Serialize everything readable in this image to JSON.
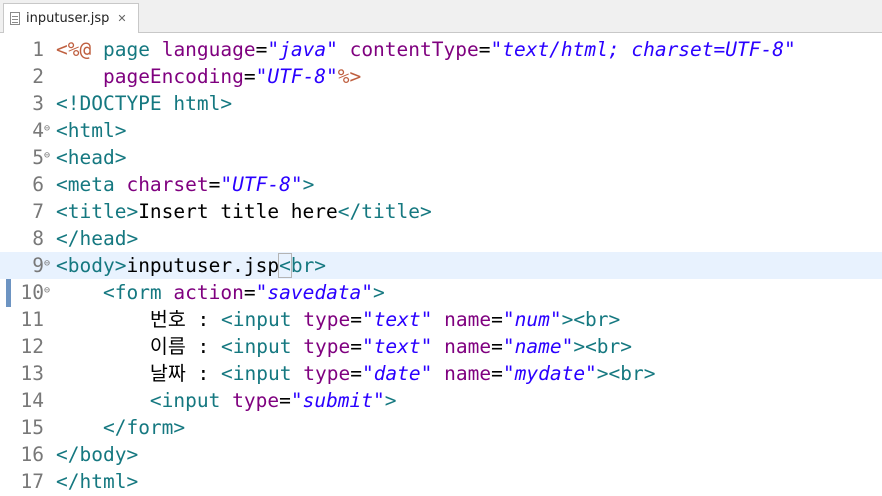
{
  "tab": {
    "filename": "inputuser.jsp",
    "close_glyph": "✕"
  },
  "editor": {
    "current_line": 9,
    "lines": [
      {
        "num": "1",
        "fold": false,
        "tokens": [
          {
            "t": "<%@",
            "c": "jsp"
          },
          {
            "t": " "
          },
          {
            "t": "page",
            "c": "tag"
          },
          {
            "t": " "
          },
          {
            "t": "language",
            "c": "attr"
          },
          {
            "t": "="
          },
          {
            "t": "\"java\"",
            "c": "str"
          },
          {
            "t": " "
          },
          {
            "t": "contentType",
            "c": "attr"
          },
          {
            "t": "="
          },
          {
            "t": "\"text/html; charset=UTF-8\"",
            "c": "str"
          }
        ]
      },
      {
        "num": "2",
        "fold": false,
        "tokens": [
          {
            "t": "    "
          },
          {
            "t": "pageEncoding",
            "c": "attr"
          },
          {
            "t": "="
          },
          {
            "t": "\"UTF-8\"",
            "c": "str"
          },
          {
            "t": "%>",
            "c": "jsp"
          }
        ]
      },
      {
        "num": "3",
        "fold": false,
        "tokens": [
          {
            "t": "<!DOCTYPE html>",
            "c": "tag"
          }
        ]
      },
      {
        "num": "4",
        "fold": true,
        "tokens": [
          {
            "t": "<html>",
            "c": "tag"
          }
        ]
      },
      {
        "num": "5",
        "fold": true,
        "tokens": [
          {
            "t": "<head>",
            "c": "tag"
          }
        ]
      },
      {
        "num": "6",
        "fold": false,
        "tokens": [
          {
            "t": "<meta",
            "c": "tag"
          },
          {
            "t": " "
          },
          {
            "t": "charset",
            "c": "attr"
          },
          {
            "t": "="
          },
          {
            "t": "\"UTF-8\"",
            "c": "str"
          },
          {
            "t": ">",
            "c": "tag"
          }
        ]
      },
      {
        "num": "7",
        "fold": false,
        "tokens": [
          {
            "t": "<title>",
            "c": "tag"
          },
          {
            "t": "Insert title here"
          },
          {
            "t": "</title>",
            "c": "tag"
          }
        ]
      },
      {
        "num": "8",
        "fold": false,
        "tokens": [
          {
            "t": "</head>",
            "c": "tag"
          }
        ]
      },
      {
        "num": "9",
        "fold": true,
        "tokens": [
          {
            "t": "<body>",
            "c": "tag"
          },
          {
            "t": "inputuser.jsp"
          },
          {
            "t": "<",
            "c": "tag",
            "brace": true
          },
          {
            "t": "br>",
            "c": "tag"
          }
        ]
      },
      {
        "num": "10",
        "fold": true,
        "tokens": [
          {
            "t": "    "
          },
          {
            "t": "<form",
            "c": "tag"
          },
          {
            "t": " "
          },
          {
            "t": "action",
            "c": "attr"
          },
          {
            "t": "="
          },
          {
            "t": "\"savedata\"",
            "c": "str"
          },
          {
            "t": ">",
            "c": "tag"
          }
        ]
      },
      {
        "num": "11",
        "fold": false,
        "tokens": [
          {
            "t": "        번호 : "
          },
          {
            "t": "<input",
            "c": "tag"
          },
          {
            "t": " "
          },
          {
            "t": "type",
            "c": "attr"
          },
          {
            "t": "="
          },
          {
            "t": "\"text\"",
            "c": "str"
          },
          {
            "t": " "
          },
          {
            "t": "name",
            "c": "attr"
          },
          {
            "t": "="
          },
          {
            "t": "\"num\"",
            "c": "str"
          },
          {
            "t": "><br>",
            "c": "tag"
          }
        ]
      },
      {
        "num": "12",
        "fold": false,
        "tokens": [
          {
            "t": "        이름 : "
          },
          {
            "t": "<input",
            "c": "tag"
          },
          {
            "t": " "
          },
          {
            "t": "type",
            "c": "attr"
          },
          {
            "t": "="
          },
          {
            "t": "\"text\"",
            "c": "str"
          },
          {
            "t": " "
          },
          {
            "t": "name",
            "c": "attr"
          },
          {
            "t": "="
          },
          {
            "t": "\"name\"",
            "c": "str"
          },
          {
            "t": "><br>",
            "c": "tag"
          }
        ]
      },
      {
        "num": "13",
        "fold": false,
        "tokens": [
          {
            "t": "        날짜 : "
          },
          {
            "t": "<input",
            "c": "tag"
          },
          {
            "t": " "
          },
          {
            "t": "type",
            "c": "attr"
          },
          {
            "t": "="
          },
          {
            "t": "\"date\"",
            "c": "str"
          },
          {
            "t": " "
          },
          {
            "t": "name",
            "c": "attr"
          },
          {
            "t": "="
          },
          {
            "t": "\"mydate\"",
            "c": "str"
          },
          {
            "t": "><br>",
            "c": "tag"
          }
        ]
      },
      {
        "num": "14",
        "fold": false,
        "tokens": [
          {
            "t": "        "
          },
          {
            "t": "<input",
            "c": "tag"
          },
          {
            "t": " "
          },
          {
            "t": "type",
            "c": "attr"
          },
          {
            "t": "="
          },
          {
            "t": "\"submit\"",
            "c": "str"
          },
          {
            "t": ">",
            "c": "tag"
          }
        ]
      },
      {
        "num": "15",
        "fold": false,
        "tokens": [
          {
            "t": "    "
          },
          {
            "t": "</form>",
            "c": "tag"
          }
        ]
      },
      {
        "num": "16",
        "fold": false,
        "tokens": [
          {
            "t": "</body>",
            "c": "tag"
          }
        ]
      },
      {
        "num": "17",
        "fold": false,
        "tokens": [
          {
            "t": "</html>",
            "c": "tag"
          }
        ]
      }
    ]
  },
  "colors": {
    "tag": "#157880",
    "attr": "#7f007f",
    "string": "#2a00ff",
    "jsp_delimiter": "#bf5f3f",
    "line_number": "#787878",
    "current_line_bg": "#e8f2fe",
    "change_marker": "#6d94c2"
  },
  "icons": {
    "tab_file": "jsp-file-icon",
    "fold": "fold-collapse-icon"
  }
}
